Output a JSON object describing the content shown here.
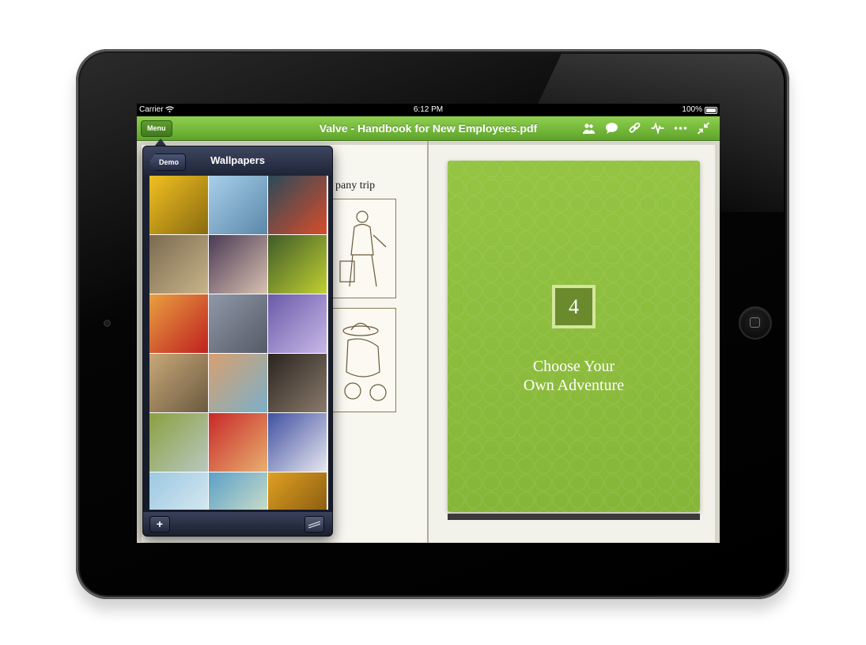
{
  "status_bar": {
    "carrier": "Carrier",
    "time": "6:12 PM",
    "battery": "100%"
  },
  "nav_bar": {
    "menu_label": "Menu",
    "title": "Valve - Handbook for New Employees.pdf",
    "icons": [
      "people-icon",
      "comment-icon",
      "link-icon",
      "activity-icon",
      "more-icon",
      "collapse-icon"
    ],
    "tint": "#6bb233"
  },
  "document": {
    "left_page_heading": "pany trip",
    "chapter_number": "4",
    "chapter_title_line1": "Choose Your",
    "chapter_title_line2": "Own Adventure",
    "card_color": "#8fbf3e"
  },
  "popover": {
    "back_label": "Demo",
    "title": "Wallpapers",
    "add_label": "+",
    "wallpapers": [
      {
        "name": "yellow-rope",
        "colors": [
          "#f0c020",
          "#8a6a10"
        ]
      },
      {
        "name": "blue-branches",
        "colors": [
          "#a8d0ec",
          "#5b87a8"
        ]
      },
      {
        "name": "traffic-light",
        "colors": [
          "#2a4a5a",
          "#d84c2a"
        ]
      },
      {
        "name": "chipmunk",
        "colors": [
          "#7a6a50",
          "#c9b48a"
        ]
      },
      {
        "name": "toy-bike",
        "colors": [
          "#4a3a55",
          "#d8c0b0"
        ]
      },
      {
        "name": "green-card",
        "colors": [
          "#3f5a2a",
          "#c0d030"
        ]
      },
      {
        "name": "sunset-red",
        "colors": [
          "#e8a040",
          "#c02020"
        ]
      },
      {
        "name": "dry-plants",
        "colors": [
          "#9098a8",
          "#555a66"
        ]
      },
      {
        "name": "purple-blur",
        "colors": [
          "#6a5aa8",
          "#c8b8e8"
        ]
      },
      {
        "name": "golden-grass",
        "colors": [
          "#c8a878",
          "#6a5a40"
        ]
      },
      {
        "name": "blossoms",
        "colors": [
          "#d8a070",
          "#7ab0c8"
        ]
      },
      {
        "name": "tree-bark",
        "colors": [
          "#2a2420",
          "#8a7a6a"
        ]
      },
      {
        "name": "moss-macro",
        "colors": [
          "#8aa040",
          "#b8c8c0"
        ]
      },
      {
        "name": "red-bokeh",
        "colors": [
          "#c82828",
          "#e8b070"
        ]
      },
      {
        "name": "blue-ice",
        "colors": [
          "#4050a0",
          "#e8e8f0"
        ]
      },
      {
        "name": "sky-light",
        "colors": [
          "#9cc8e0",
          "#e0eef4"
        ]
      },
      {
        "name": "white-flower",
        "colors": [
          "#5aa0c8",
          "#e0e8c8"
        ]
      },
      {
        "name": "amber-bokeh",
        "colors": [
          "#e0a020",
          "#7a5010"
        ]
      }
    ]
  }
}
